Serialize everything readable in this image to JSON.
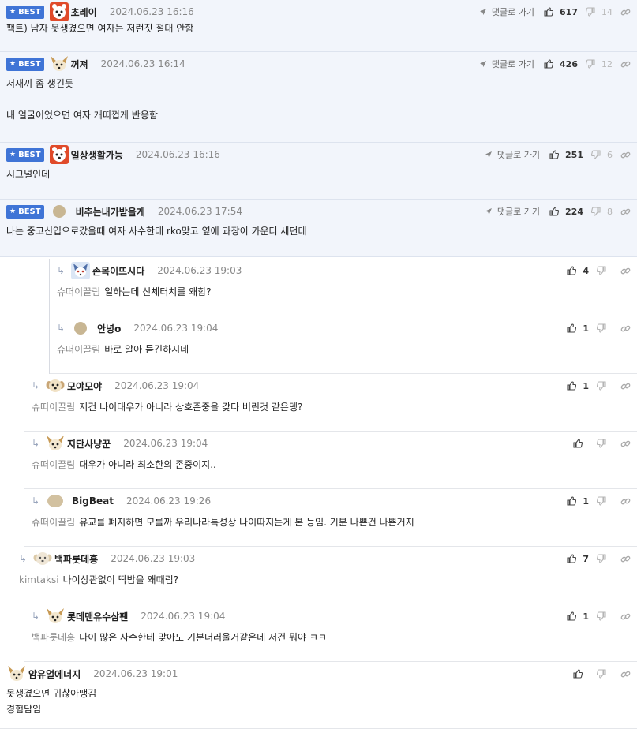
{
  "best_label": "BEST",
  "goto_reply_label": "댓글로 가기",
  "comments": [
    {
      "id": 0,
      "best": true,
      "nick": "초레이",
      "date": "2024.06.23 16:16",
      "avatar": "red-bear",
      "text": "팩트) 남자 못생겼으면 여자는 저런짓 절대 안함",
      "up": "617",
      "down": "14",
      "goto": true
    },
    {
      "id": 1,
      "best": true,
      "nick": "꺼져",
      "date": "2024.06.23 16:14",
      "avatar": "fennec",
      "text": "저새끼 좀 생긴듯\n\n내 얼굴이었으면 여자 개띠껍게 반응함",
      "up": "426",
      "down": "12",
      "goto": true
    },
    {
      "id": 2,
      "best": true,
      "nick": "일상생활가능",
      "date": "2024.06.23 16:16",
      "avatar": "red-bear",
      "text": "시그널인데",
      "up": "251",
      "down": "6",
      "goto": true
    },
    {
      "id": 3,
      "best": true,
      "nick": "비추는내가받을게",
      "date": "2024.06.23 17:54",
      "avatar": "dot",
      "text": "나는 중고신입으로갔을때 여자 사수한테 rko맞고 옆에 과장이 카운터 세던데",
      "up": "224",
      "down": "8",
      "goto": true
    },
    {
      "id": 4,
      "best": false,
      "nick": "손목이뜨시다",
      "date": "2024.06.23 19:03",
      "avatar": "blue-fox",
      "mention": "슈떠이끌림",
      "text": "일하는데 신체터치를 왜함?",
      "up": "4",
      "down": "",
      "goto": false
    },
    {
      "id": 5,
      "best": false,
      "nick": "안녕o",
      "date": "2024.06.23 19:04",
      "avatar": "dot",
      "mention": "슈떠이끌림",
      "text": "바로 알아 듣긴하시네",
      "up": "1",
      "down": "",
      "goto": false
    },
    {
      "id": 6,
      "best": false,
      "nick": "모야모야",
      "date": "2024.06.23 19:04",
      "avatar": "dog",
      "mention": "슈떠이끌림",
      "text": "저건 나이대우가 아니라 상호존중을 갖다 버린것 같은뎅?",
      "up": "1",
      "down": "",
      "goto": false
    },
    {
      "id": 7,
      "best": false,
      "nick": "지단사냥꾼",
      "date": "2024.06.23 19:04",
      "avatar": "fennec",
      "mention": "슈떠이끌림",
      "text": "대우가 아니라 최소한의 존중이지..",
      "up": "",
      "down": "",
      "goto": false
    },
    {
      "id": 8,
      "best": false,
      "nick": "BigBeat",
      "date": "2024.06.23 19:26",
      "avatar": "dot-large",
      "mention": "슈떠이끌림",
      "text": "유교를 폐지하면 모를까 우리나라특성상 나이따지는게 본 능임. 기분 나쁜건 나쁜거지",
      "up": "1",
      "down": "",
      "goto": false
    },
    {
      "id": 9,
      "best": false,
      "nick": "백파롯데홍",
      "date": "2024.06.23 19:03",
      "avatar": "dog-light",
      "mention": "kimtaksi",
      "text": "나이상관없이 딱밤을 왜때림?",
      "up": "7",
      "down": "",
      "goto": false
    },
    {
      "id": 10,
      "best": false,
      "nick": "롯데맨유수삼팬",
      "date": "2024.06.23 19:04",
      "avatar": "fennec",
      "mention": "백파롯데홍",
      "text": "나이 많은 사수한테 맞아도 기분더러울거같은데 저건 뭐야 ㅋㅋ",
      "up": "1",
      "down": "",
      "goto": false
    },
    {
      "id": 11,
      "best": false,
      "nick": "암유얼에너지",
      "date": "2024.06.23 19:01",
      "avatar": "fennec",
      "text": "못생겼으면 귀찮아땡김\n경험담임",
      "up": "",
      "down": "",
      "goto": false
    }
  ]
}
